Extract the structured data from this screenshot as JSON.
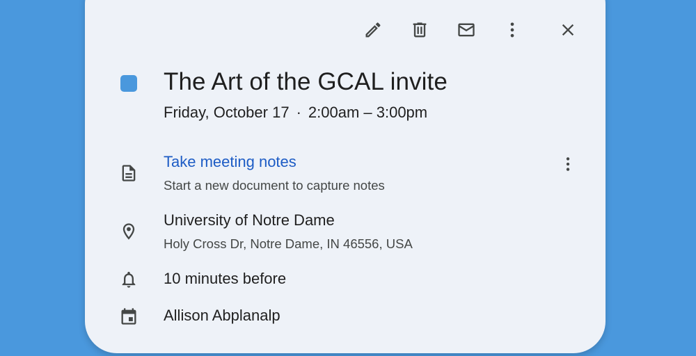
{
  "toolbar": {
    "icons": [
      "edit-icon",
      "delete-icon",
      "email-icon",
      "more-options-icon",
      "close-icon"
    ]
  },
  "event": {
    "color": "#4a98dd",
    "title": "The Art of the GCAL invite",
    "date": "Friday, October 17",
    "separator": "·",
    "time": "2:00am – 3:00pm"
  },
  "notes": {
    "icon": "document-icon",
    "label": "Take meeting notes",
    "description": "Start a new document to capture notes"
  },
  "location": {
    "icon": "location-pin-icon",
    "name": "University of Notre Dame",
    "address": "Holy Cross Dr, Notre Dame, IN 46556, USA"
  },
  "reminder": {
    "icon": "bell-icon",
    "text": "10 minutes before"
  },
  "calendar": {
    "icon": "calendar-icon",
    "owner": "Allison Abplanalp"
  },
  "colors": {
    "background": "#4a98dd",
    "card": "#eef2f8",
    "link": "#1d5cc5",
    "text": "#1f1f1f",
    "secondary_text": "#444746"
  }
}
